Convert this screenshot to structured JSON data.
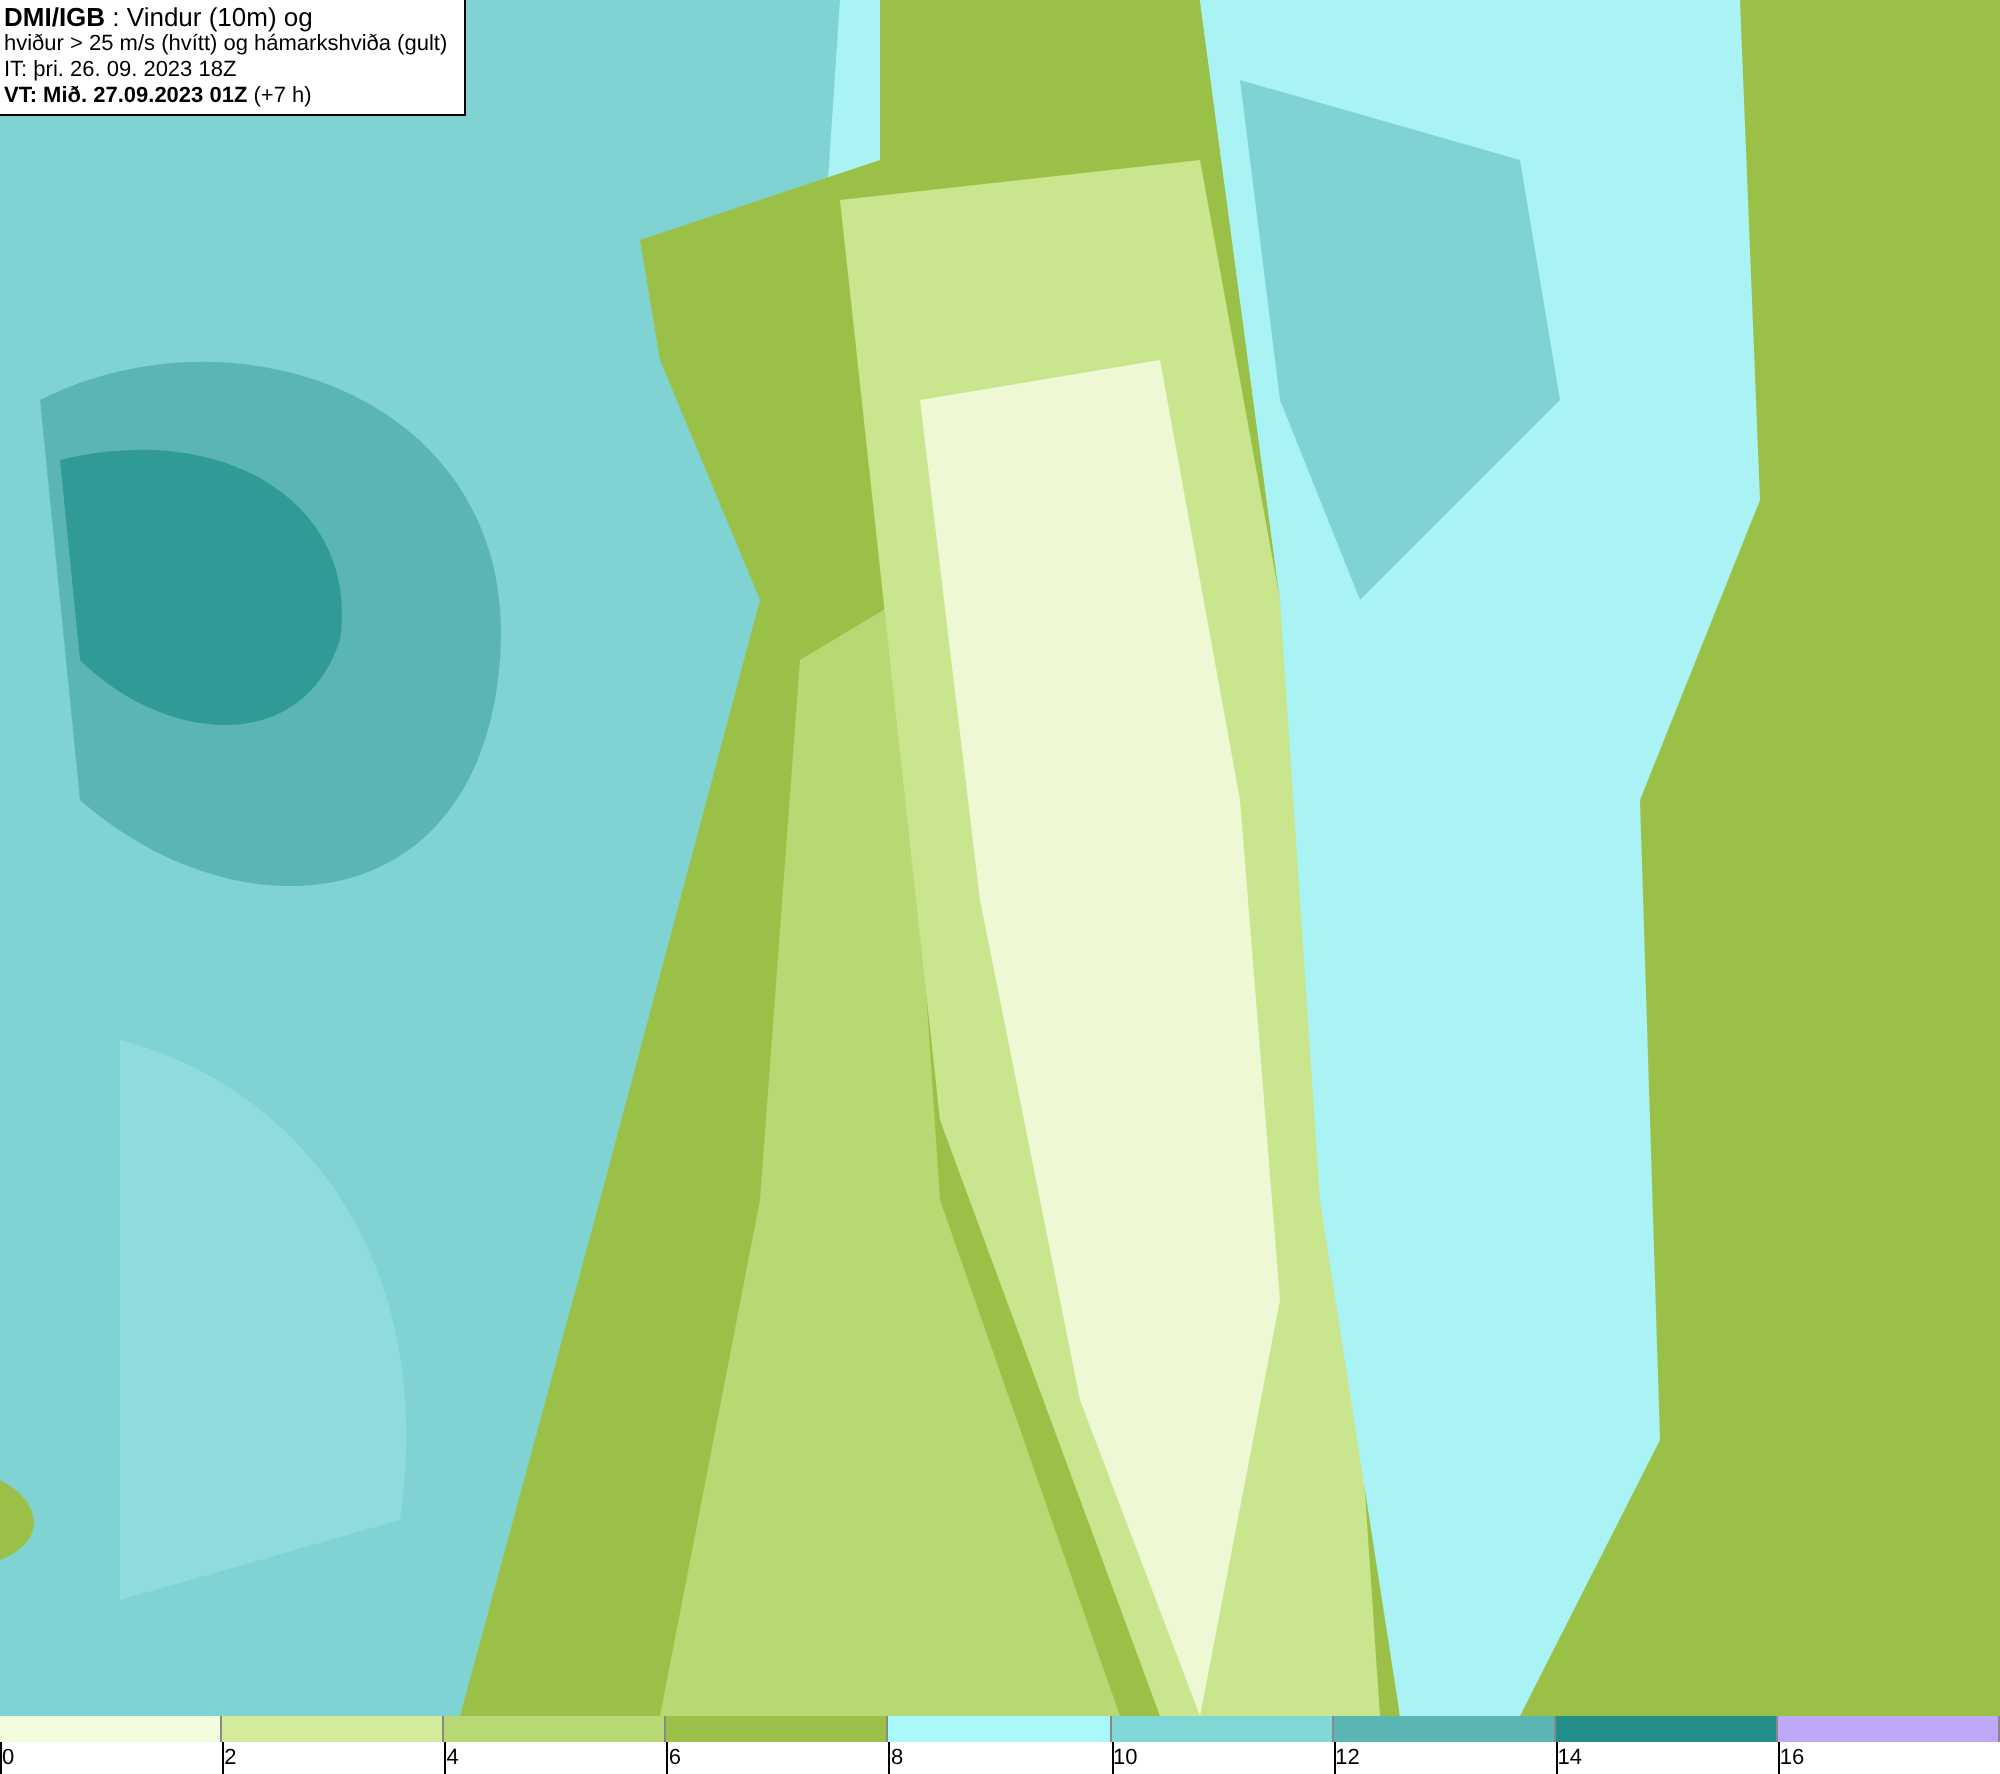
{
  "header": {
    "lines": [
      "**DMI/IGB** : Vindur (10m) og",
      "hviður > 25 m/s (hvítt) og hámarkshviða (gult)",
      "IT: þri. 26. 09. 2023 18Z",
      "**VT: Mið. 27.09.2023 01Z** (+7 h)"
    ]
  },
  "legend": {
    "bins": [
      {
        "color": "#f3fbdd"
      },
      {
        "color": "#d2ec9c"
      },
      {
        "color": "#b6d974"
      },
      {
        "color": "#9bc048"
      },
      {
        "color": "#a9f9fb"
      },
      {
        "color": "#7fd8d6"
      },
      {
        "color": "#5bb6b3"
      },
      {
        "color": "#238f8b"
      },
      {
        "color": "#c0a8f8"
      }
    ],
    "ticks": [
      "0",
      "2",
      "4",
      "6",
      "8",
      "10",
      "12",
      "14",
      "16"
    ]
  }
}
